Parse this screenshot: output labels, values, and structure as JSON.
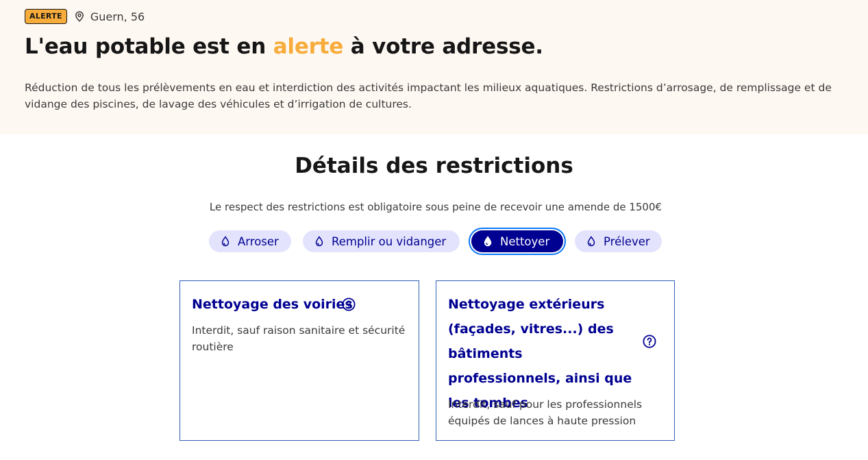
{
  "alert": {
    "badge": "ALERTE",
    "location": "Guern, 56",
    "title_before": "L'eau potable est en ",
    "title_highlight": "alerte",
    "title_after": " à votre adresse.",
    "description": "Réduction de tous les prélèvements en eau et interdiction des activités impactant les milieux aquatiques. Restrictions d’arrosage, de remplissage et de vidange des piscines, de lavage des véhicules et d’irrigation de cultures."
  },
  "restrictions": {
    "title": "Détails des restrictions",
    "subtitle": "Le respect des restrictions est obligatoire sous peine de recevoir une amende de 1500€",
    "tabs": [
      {
        "label": "Arroser",
        "icon": "water-drop-icon",
        "active": false
      },
      {
        "label": "Remplir ou vidanger",
        "icon": "water-drop-icon",
        "active": false
      },
      {
        "label": "Nettoyer",
        "icon": "water-drop-icon",
        "active": true
      },
      {
        "label": "Prélever",
        "icon": "water-drop-icon",
        "active": false
      }
    ],
    "cards": [
      {
        "title": "Nettoyage des voiries",
        "body": "Interdit, sauf raison sanitaire et sécurité routière",
        "icon": "help-icon"
      },
      {
        "title": "Nettoyage extérieurs (façades, vitres...) des bâtiments professionnels, ainsi que les tombes",
        "body": "Interdit, sauf pour les professionnels équipés de lances à haute pression",
        "icon": "help-icon"
      }
    ]
  },
  "colors": {
    "hero_background": "#fef8f2",
    "alert_accent": "#f7ac3b",
    "primary_blue": "#000091",
    "tab_background": "#e3e3fd",
    "card_border": "#2e5fb5"
  }
}
